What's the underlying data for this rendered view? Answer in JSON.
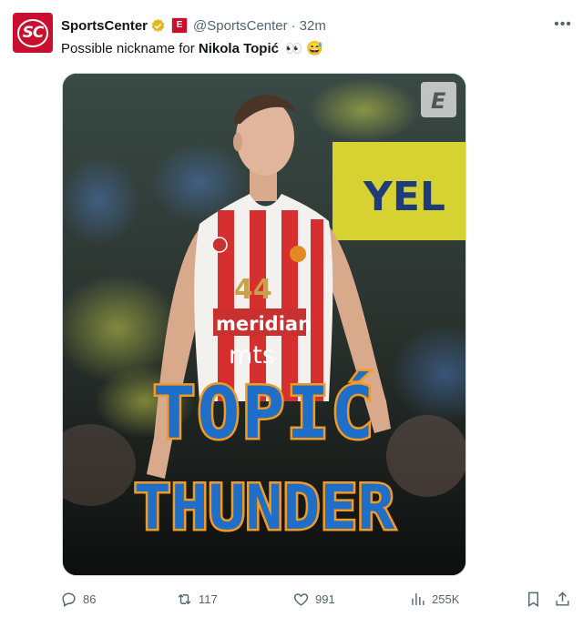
{
  "account": {
    "name": "SportsCenter",
    "handle": "@SportsCenter",
    "separator": "·",
    "time": "32m",
    "avatar_text": "SC",
    "affiliate_badge": "E"
  },
  "tweet": {
    "text_prefix": "Possible nickname for ",
    "text_bold": "Nikola Topić",
    "text_emoji": "👀 😅"
  },
  "media": {
    "jersey_number": "44",
    "jersey_sponsor": "meridian",
    "jersey_sponsor2": "mts",
    "banner_text": "YEL",
    "title_line1": "TOPIĆ",
    "title_line2": "THUNDER",
    "corner_logo": "E"
  },
  "actions": {
    "replies": "86",
    "reposts": "117",
    "likes": "991",
    "views": "255K"
  },
  "icons": [
    "verified-badge-icon",
    "more-icon",
    "reply-icon",
    "repost-icon",
    "like-icon",
    "views-icon",
    "bookmark-icon",
    "share-icon"
  ],
  "colors": {
    "brand_red": "#c8102e",
    "verified_gold": "#e2b719",
    "text_secondary": "#536471",
    "title_blue": "#1f6fc9",
    "title_orange": "#f39a1f"
  }
}
